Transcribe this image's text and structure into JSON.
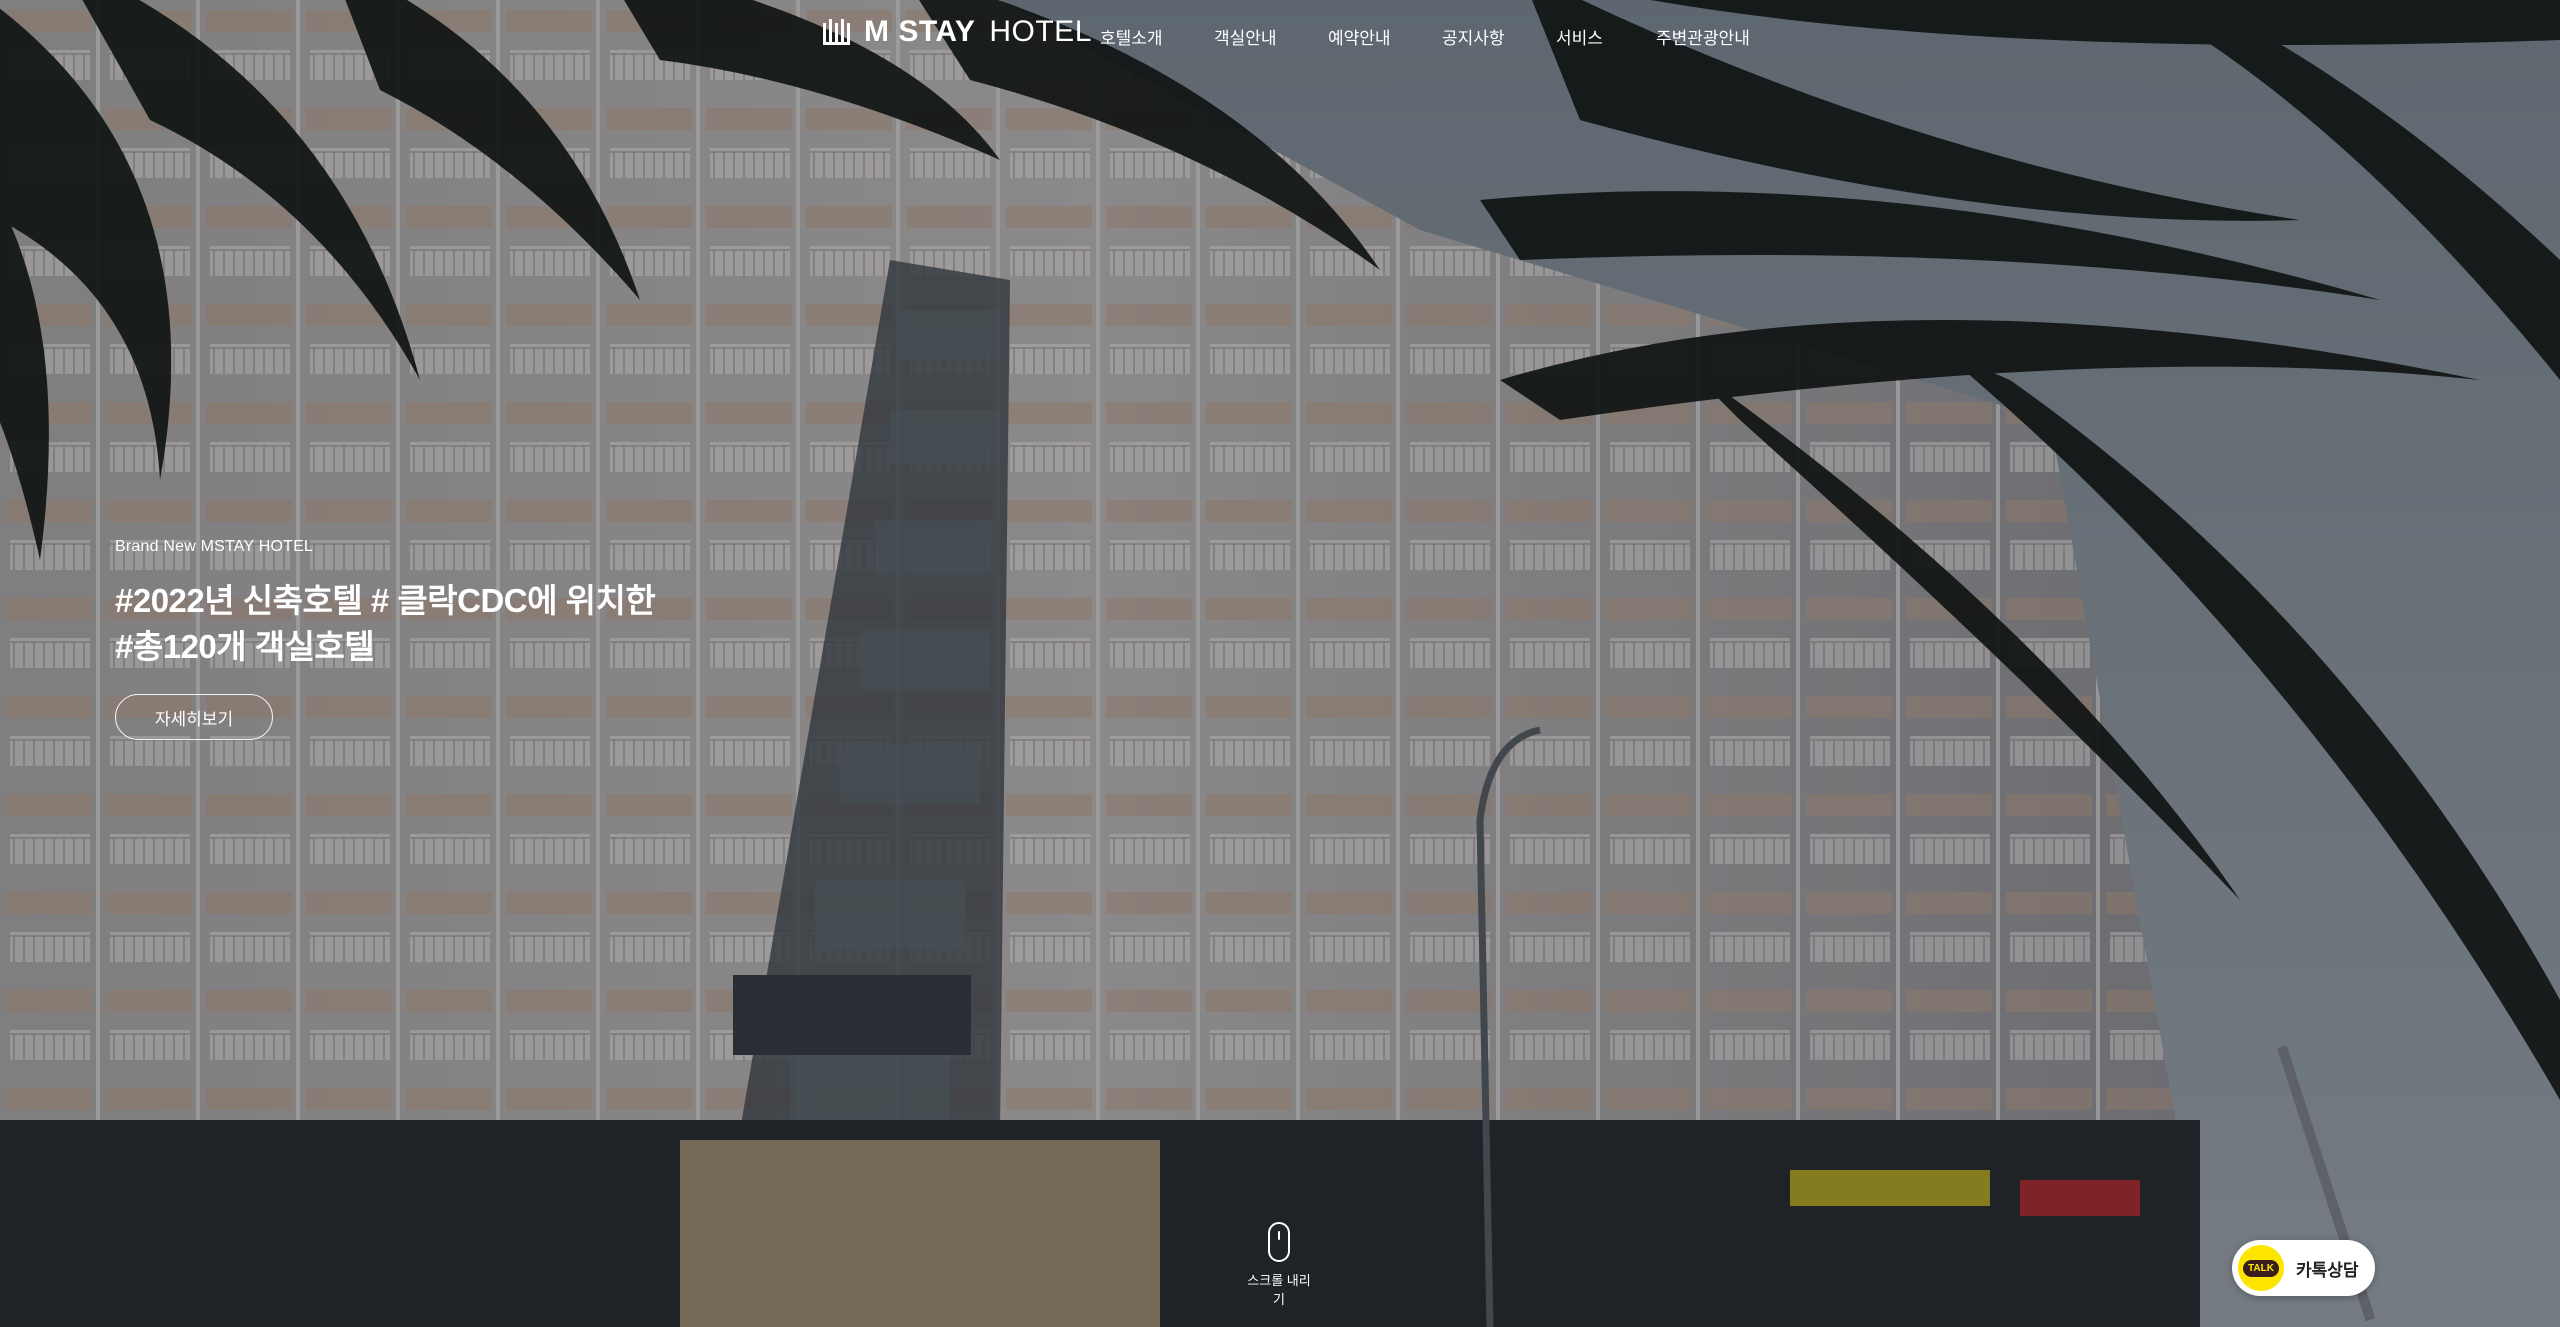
{
  "header": {
    "logo_strong": "M STAY",
    "logo_light": "HOTEL",
    "nav": [
      {
        "label": "호텔소개"
      },
      {
        "label": "객실안내"
      },
      {
        "label": "예약안내"
      },
      {
        "label": "공지사항"
      },
      {
        "label": "서비스"
      },
      {
        "label": "주변관광안내"
      }
    ]
  },
  "hero": {
    "eyebrow": "Brand New MSTAY HOTEL",
    "headline_line1": "#2022년 신축호텔 # 클락CDC에 위치한",
    "headline_line2": "#총120개 객실호텔",
    "button_label": "자세히보기"
  },
  "scroll": {
    "label": "스크롤 내리기"
  },
  "kakao": {
    "badge": "TALK",
    "label": "카톡상담",
    "color": "#fee500"
  },
  "colors": {
    "overlay": "#14161c",
    "accent": "#ffffff"
  }
}
